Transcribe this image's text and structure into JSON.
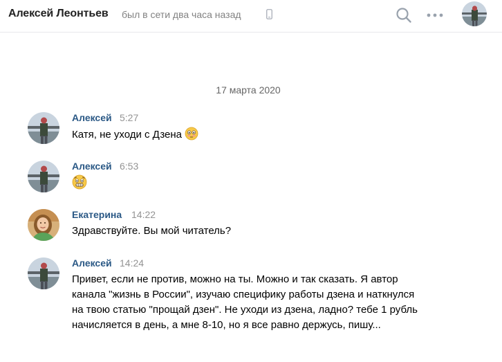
{
  "header": {
    "contact_name": "Алексей Леонтьев",
    "status": "был в сети два часа назад",
    "icons": [
      "phone-icon",
      "search-icon",
      "more-icon",
      "avatar"
    ]
  },
  "date_divider": "17 марта 2020",
  "messages": [
    {
      "author": "Алексей",
      "time": "5:27",
      "text": "Катя, не уходи с Дзена",
      "emoji": "flushed-face-emoji"
    },
    {
      "author": "Алексей",
      "time": "6:53",
      "text": "",
      "emoji": "grimacing-face-emoji"
    },
    {
      "author": "Екатерина",
      "time": "14:22",
      "text": "Здравствуйте. Вы мой читатель?"
    },
    {
      "author": "Алексей",
      "time": "14:24",
      "text": "Привет, если не против, можно на ты. Можно и так сказать. Я автор канала \"жизнь в России\", изучаю специфику работы дзена и наткнулся на твою статью \"прощай дзен\". Не уходи из дзена, ладно? тебе 1 рубль начисляется в день, а мне 8-10, но я все равно держусь, пишу..."
    }
  ],
  "colors": {
    "author_link": "#2a5885",
    "muted": "#939393",
    "divider": "#e7e8ec"
  }
}
